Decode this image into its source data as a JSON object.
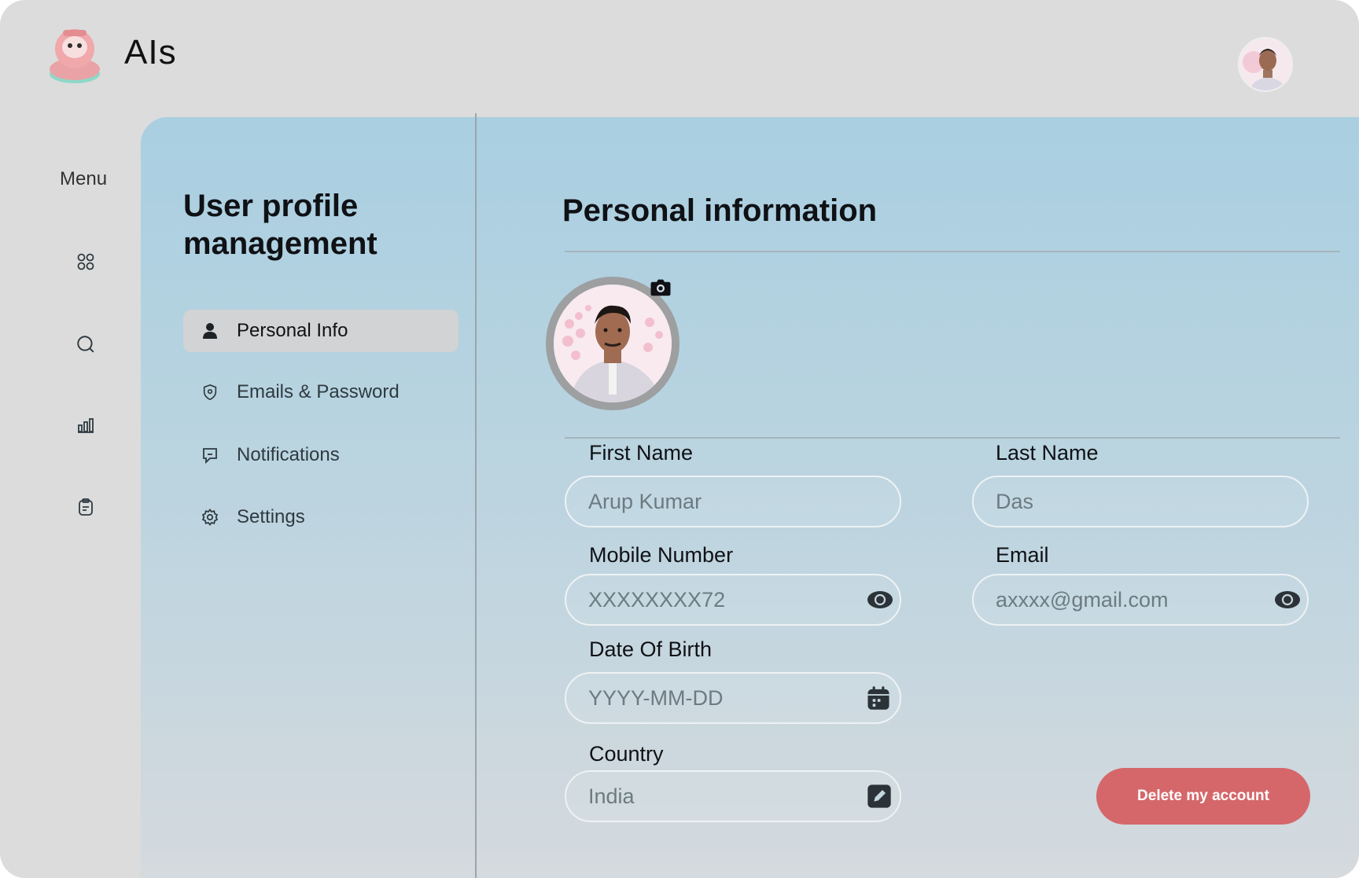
{
  "app": {
    "brand": "AIs"
  },
  "menu": {
    "label": "Menu",
    "icons": [
      "dashboard-grid-icon",
      "search-icon",
      "bar-chart-icon",
      "clipboard-icon"
    ]
  },
  "sidebar": {
    "title": "User profile management",
    "items": [
      {
        "label": "Personal Info",
        "icon": "user-icon",
        "active": true
      },
      {
        "label": "Emails & Password",
        "icon": "shield-icon",
        "active": false
      },
      {
        "label": "Notifications",
        "icon": "chat-bubble-icon",
        "active": false
      },
      {
        "label": "Settings",
        "icon": "gear-icon",
        "active": false
      }
    ]
  },
  "main": {
    "title": "Personal information",
    "fields": {
      "first_name": {
        "label": "First Name",
        "placeholder": "Arup Kumar"
      },
      "last_name": {
        "label": "Last Name",
        "placeholder": "Das"
      },
      "mobile": {
        "label": "Mobile Number",
        "placeholder": "XXXXXXXX72",
        "icon": "eye-icon"
      },
      "email": {
        "label": "Email",
        "placeholder": "axxxx@gmail.com",
        "icon": "eye-icon"
      },
      "dob": {
        "label": "Date Of Birth",
        "placeholder": "YYYY-MM-DD",
        "icon": "calendar-icon"
      },
      "country": {
        "label": "Country",
        "placeholder": "India",
        "icon": "edit-icon"
      }
    },
    "delete_label": "Delete my account"
  },
  "colors": {
    "panel_top": "#a9cfe1",
    "panel_bottom": "#d6dadd",
    "danger": "#d5676a",
    "active_nav": "#d1d3d5"
  }
}
